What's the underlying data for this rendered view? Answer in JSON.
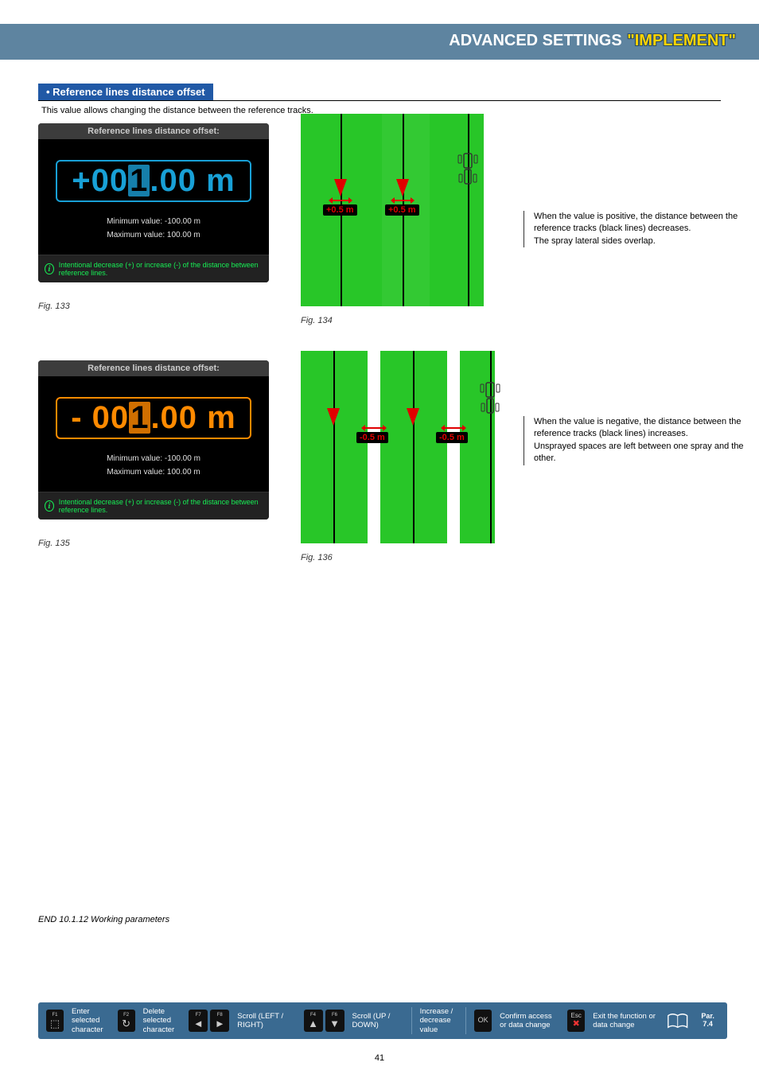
{
  "header": {
    "title_left": "ADVANCED SETTINGS ",
    "title_quoted": "\"IMPLEMENT\""
  },
  "section": {
    "bullet_title": "• Reference lines distance offset",
    "desc": "This value allows changing the distance between the reference tracks."
  },
  "panel1": {
    "title": "Reference lines distance offset:",
    "value_prefix": "+00",
    "value_cursor": "1",
    "value_suffix": ".00 m",
    "min": "Minimum value:   -100.00 m",
    "max": "Maximum value:   100.00 m",
    "info": "Intentional decrease (+) or increase (-) of the distance between reference lines.",
    "fig": "Fig. 133"
  },
  "diagram1": {
    "chip_left": "+0.5 m",
    "chip_right": "+0.5 m",
    "fig": "Fig. 134",
    "side": "When the value is positive, the distance between the reference tracks (black lines) decreases.\nThe spray lateral sides overlap."
  },
  "panel2": {
    "title": "Reference lines distance offset:",
    "value_prefix": "- 00",
    "value_cursor": "1",
    "value_suffix": ".00 m",
    "min": "Minimum value:   -100.00 m",
    "max": "Maximum value:   100.00 m",
    "info": "Intentional decrease (+) or increase (-) of the distance between reference lines.",
    "fig": "Fig. 135"
  },
  "diagram2": {
    "chip_left": "-0.5 m",
    "chip_right": "-0.5 m",
    "fig": "Fig. 136",
    "side": "When the value is negative, the distance between the reference tracks (black lines) increases.\nUnsprayed spaces are left between one spray and the other."
  },
  "endnote": "END 10.1.12 Working parameters",
  "footer": {
    "f1": "Enter selected character",
    "f2": "Delete selected character",
    "scroll_lr": "Scroll (LEFT / RIGHT)",
    "scroll_ud": "Scroll (UP / DOWN)",
    "incdec": "Increase / decrease value",
    "ok": "Confirm access or data change",
    "esc": "Exit the function or data change",
    "par": "Par. 7.4",
    "keys": {
      "f1": "F1",
      "f2": "F2",
      "f7": "F7",
      "f8": "F8",
      "f4": "F4",
      "f6": "F6",
      "ok": "OK",
      "esc": "Esc"
    }
  },
  "pagenum": "41"
}
